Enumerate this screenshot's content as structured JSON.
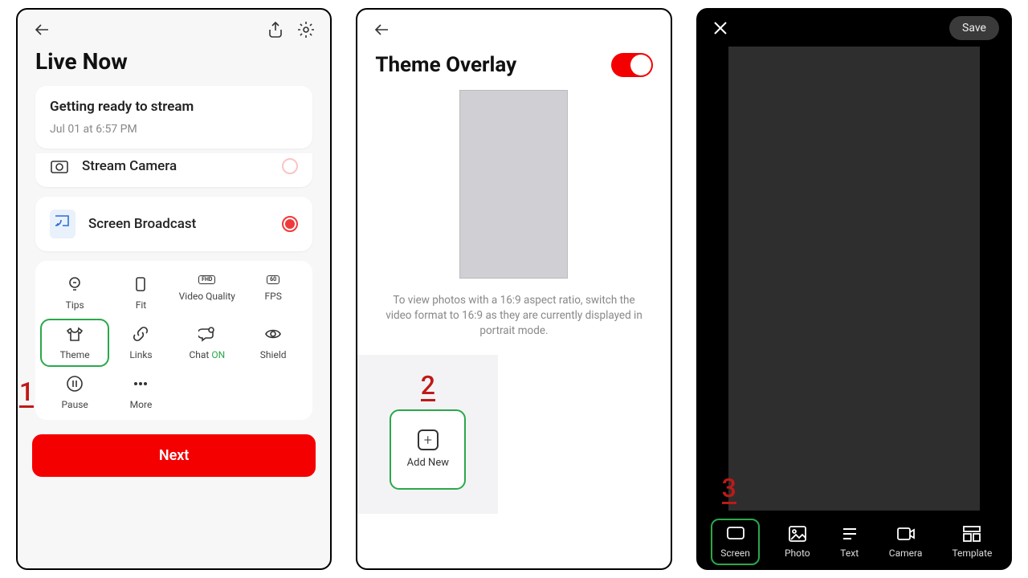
{
  "annotations": {
    "one": "1",
    "two": "2",
    "three": "3"
  },
  "screen1": {
    "title": "Live Now",
    "status_card": {
      "title": "Getting ready to stream",
      "timestamp": "Jul 01 at 6:57 PM"
    },
    "sources": {
      "camera": "Stream Camera",
      "broadcast": "Screen Broadcast"
    },
    "grid": {
      "tips": "Tips",
      "fit": "Fit",
      "video_quality": "Video Quality",
      "fps": "FPS",
      "theme": "Theme",
      "links": "Links",
      "chat": "Chat ",
      "chat_on": "ON",
      "shield": "Shield",
      "pause": "Pause",
      "more": "More",
      "fhd_badge": "FHD",
      "fps_badge": "60"
    },
    "next_button": "Next"
  },
  "screen2": {
    "title": "Theme Overlay",
    "help": "To view photos with a 16:9 aspect ratio, switch the video format to 16:9 as they are currently displayed in portrait mode.",
    "add_new": "Add New"
  },
  "screen3": {
    "save": "Save",
    "tools": {
      "screen": "Screen",
      "photo": "Photo",
      "text": "Text",
      "camera": "Camera",
      "template": "Template"
    }
  }
}
